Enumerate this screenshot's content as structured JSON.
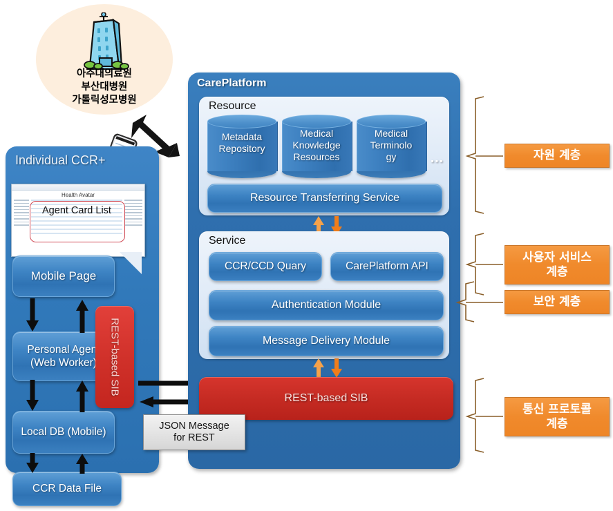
{
  "hospital": {
    "icon": "hospital-building-icon",
    "lines": [
      "아주대의료원",
      "부산대병원",
      "가톨릭성모병원"
    ],
    "line1": "아주대의료원",
    "line2": "부산대병원",
    "line3": "가톨릭성모병원"
  },
  "connector": {
    "hospital_platform_arrow": "double-headed-diagonal-arrow",
    "phone": "smartphone-icon"
  },
  "individual_ccr": {
    "title": "Individual CCR+",
    "thumbnail": {
      "window_title": "Health Avatar",
      "highlight_label": "Agent Card List"
    },
    "boxes": {
      "mobile_page": "Mobile Page",
      "personal_agent": "Personal Agent\n(Web Worker)",
      "personal_agent_line1": "Personal Agent",
      "personal_agent_line2": "(Web Worker)",
      "local_db": "Local DB (Mobile)",
      "ccr_data_file": "CCR Data File"
    },
    "rest_sib_vertical": "REST-based SIB"
  },
  "careplatform": {
    "title": "CarePlatform",
    "resource": {
      "label": "Resource",
      "stores": [
        {
          "name": "Metadata Repository",
          "line1": "Metadata",
          "line2": "Repository"
        },
        {
          "name": "Medical Knowledge Resources",
          "line1": "Medical",
          "line2": "Knowledge",
          "line3": "Resources"
        },
        {
          "name": "Medical Terminology",
          "line1": "Medical",
          "line2": "Terminolo",
          "line3": "gy"
        }
      ],
      "ellipsis": "…",
      "transfer_service": "Resource Transferring Service"
    },
    "service": {
      "label": "Service",
      "ccr_ccd_query": "CCR/CCD Quary",
      "careplatform_api": "CarePlatform API",
      "authentication_module": "Authentication Module",
      "message_delivery_module": "Message Delivery Module"
    },
    "rest_sib": "REST-based SIB"
  },
  "json_message": {
    "line1": "JSON Message",
    "line2": "for REST"
  },
  "layers": [
    {
      "label": "자원 계층"
    },
    {
      "label": "사용자 서비스\n계층",
      "line1": "사용자 서비스",
      "line2": "계층"
    },
    {
      "label": "보안 계층"
    },
    {
      "label": "통신 프로토콜\n계층",
      "line1": "통신 프로토콜",
      "line2": "계층"
    }
  ],
  "layer_resource": "자원 계층",
  "layer_user_service_line1": "사용자 서비스",
  "layer_user_service_line2": "계층",
  "layer_security": "보안 계층",
  "layer_comm_line1": "통신 프로토콜",
  "layer_comm_line2": "계층",
  "colors": {
    "platform_blue": "#2f6fae",
    "panel_blue": "#3179ba",
    "box_blue": "#3e84c4",
    "red_sib": "#c42a22",
    "orange_layer": "#f08a2c",
    "bracket": "#9a6a2f",
    "hospital_ellipse": "#fdeedd"
  }
}
